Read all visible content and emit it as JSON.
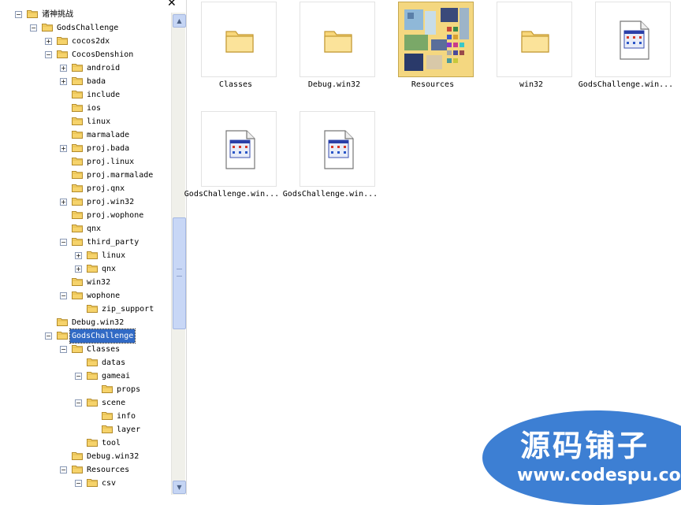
{
  "close_glyph": "✕",
  "tree": {
    "nodes": [
      {
        "label": "诸神挑战",
        "expander": "−"
      },
      {
        "label": "GodsChallenge",
        "expander": "−"
      },
      {
        "label": "cocos2dx",
        "expander": "+"
      },
      {
        "label": "CocosDenshion",
        "expander": "−"
      },
      {
        "label": "android",
        "expander": "+"
      },
      {
        "label": "bada",
        "expander": "+"
      },
      {
        "label": "include",
        "expander": ""
      },
      {
        "label": "ios",
        "expander": ""
      },
      {
        "label": "linux",
        "expander": ""
      },
      {
        "label": "marmalade",
        "expander": ""
      },
      {
        "label": "proj.bada",
        "expander": "+"
      },
      {
        "label": "proj.linux",
        "expander": ""
      },
      {
        "label": "proj.marmalade",
        "expander": ""
      },
      {
        "label": "proj.qnx",
        "expander": ""
      },
      {
        "label": "proj.win32",
        "expander": "+"
      },
      {
        "label": "proj.wophone",
        "expander": ""
      },
      {
        "label": "qnx",
        "expander": ""
      },
      {
        "label": "third_party",
        "expander": "−"
      },
      {
        "label": "linux",
        "expander": "+"
      },
      {
        "label": "qnx",
        "expander": "+"
      },
      {
        "label": "win32",
        "expander": ""
      },
      {
        "label": "wophone",
        "expander": "−"
      },
      {
        "label": "zip_support",
        "expander": ""
      },
      {
        "label": "Debug.win32",
        "expander": ""
      },
      {
        "label": "GodsChallenge",
        "expander": "−",
        "selected": true
      },
      {
        "label": "Classes",
        "expander": "−"
      },
      {
        "label": "datas",
        "expander": ""
      },
      {
        "label": "gameai",
        "expander": "−"
      },
      {
        "label": "props",
        "expander": ""
      },
      {
        "label": "scene",
        "expander": "−"
      },
      {
        "label": "info",
        "expander": ""
      },
      {
        "label": "layer",
        "expander": ""
      },
      {
        "label": "tool",
        "expander": ""
      },
      {
        "label": "Debug.win32",
        "expander": ""
      },
      {
        "label": "Resources",
        "expander": "−"
      },
      {
        "label": "csv",
        "expander": "−"
      }
    ]
  },
  "scrollbar": {
    "up_arrow": "▲",
    "down_arrow": "▼"
  },
  "files": [
    {
      "name": "Classes",
      "icon": "folder-icon"
    },
    {
      "name": "Debug.win32",
      "icon": "folder-icon"
    },
    {
      "name": "Resources",
      "icon": "image-folder-icon"
    },
    {
      "name": "win32",
      "icon": "folder-icon"
    },
    {
      "name": "GodsChallenge.win...",
      "icon": "app-file-icon"
    },
    {
      "name": "GodsChallenge.win...",
      "icon": "app-file-icon"
    },
    {
      "name": "GodsChallenge.win...",
      "icon": "app-file-icon"
    }
  ],
  "watermark": {
    "title": "源码铺子",
    "url": "www.codespu.com"
  },
  "colors": {
    "selection": "#316ac5",
    "folder": "#f6d36b",
    "watermark": "#3d7fd3"
  }
}
